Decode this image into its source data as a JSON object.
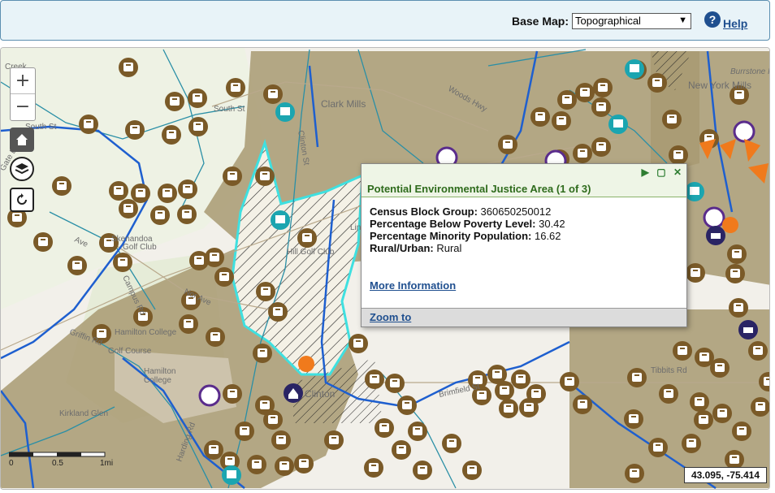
{
  "toolbar": {
    "basemap_label": "Base Map:",
    "basemap_value": "Topographical",
    "help_label": "Help"
  },
  "map": {
    "labels": [
      "Creek",
      "Gate Dr",
      "South St",
      "South St",
      "Clark Mills",
      "Woods Hwy",
      "Skenandoa",
      "Golf Club",
      "Campus Rd",
      "Hamilton College",
      "Golf Course",
      "Hamilton",
      "College",
      "Kirkland Glen",
      "Harding Rd",
      "Brimfield St",
      "Griffin Rd",
      "Clinton St",
      "New York Mills",
      "Burrstone Rd",
      "Tibbits Rd",
      "Nor Ave",
      "Ave",
      "Linton",
      "Clinton",
      "Hill Golf Club"
    ],
    "scale_labels": [
      "0",
      "0.5",
      "1mi"
    ],
    "coordinates": "43.095, -75.414"
  },
  "popup": {
    "title": "Potential Environmental Justice Area (1 of 3)",
    "fields": [
      {
        "label": "Census Block Group:",
        "value": "360650250012"
      },
      {
        "label": "Percentage Below Poverty Level:",
        "value": "30.42"
      },
      {
        "label": "Percentage Minority Population:",
        "value": "16.62"
      },
      {
        "label": "Rural/Urban:",
        "value": "Rural"
      }
    ],
    "more_info": "More Information",
    "zoom_to": "Zoom to"
  },
  "colors": {
    "ej_area": "#a89a72",
    "water": "#1e5fcf",
    "boundary": "#2a8fa6",
    "marker": "#7a5a28",
    "highlight": "#3fe0e0"
  },
  "icons": [
    "plus-icon",
    "minus-icon",
    "home-icon",
    "layers-icon",
    "refresh-icon",
    "help-icon",
    "play-icon",
    "maximize-icon",
    "close-icon",
    "facility-marker-icon",
    "water-marker-icon",
    "house-marker-icon",
    "car-marker-icon"
  ]
}
